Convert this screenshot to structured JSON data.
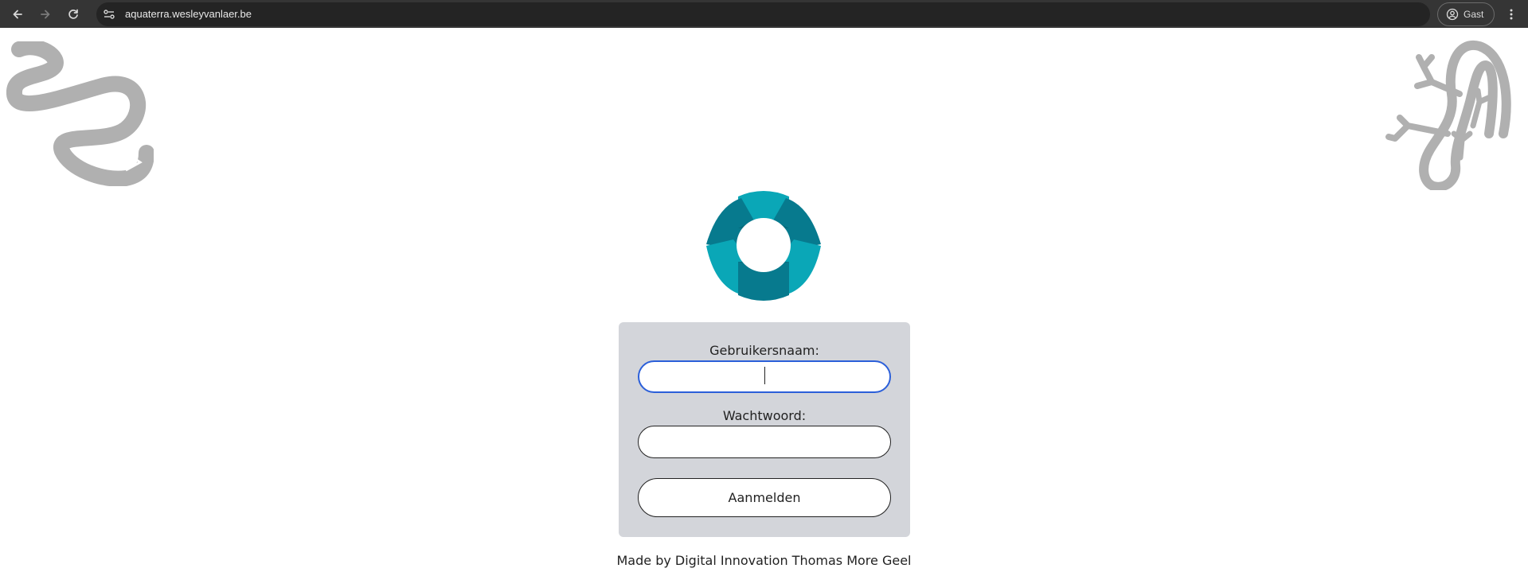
{
  "browser": {
    "url": "aquaterra.wesleyvanlaer.be",
    "profile_label": "Gast"
  },
  "login": {
    "username_label": "Gebruikersnaam:",
    "username_value": "",
    "password_label": "Wachtwoord:",
    "password_value": "",
    "submit_label": "Aanmelden"
  },
  "footer": {
    "text": "Made by Digital Innovation Thomas More Geel"
  },
  "colors": {
    "logo_light": "#0aa7b7",
    "logo_dark": "#077a8e",
    "panel_bg": "#d3d5da",
    "focus_border": "#2b5fd9",
    "decor_gray": "#b0b0b0"
  }
}
